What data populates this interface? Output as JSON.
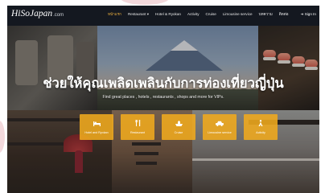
{
  "brand": {
    "logo_main": "HiSoJapan",
    "logo_suffix": ".com"
  },
  "nav": {
    "items": [
      {
        "label": "หน้าแรก",
        "active": true
      },
      {
        "label": "Restaurant ▾",
        "active": false
      },
      {
        "label": "Hotel & Ryokan",
        "active": false
      },
      {
        "label": "Activity",
        "active": false
      },
      {
        "label": "Cruise",
        "active": false
      },
      {
        "label": "Limousine service",
        "active": false
      },
      {
        "label": "บทความ",
        "active": false
      },
      {
        "label": "ติดต่อ",
        "active": false
      }
    ],
    "signin": "➜ Sign In"
  },
  "hero": {
    "headline": "ช่วยให้คุณเพลิดเพลินกับการท่องเที่ยวญี่ปุ่น",
    "subheadline": "Find great places , hotels , restaurants , shops and more for VIPs."
  },
  "categories": [
    {
      "label": "Hotel and Ryokan",
      "icon": "bed-icon"
    },
    {
      "label": "Restaurant",
      "icon": "cutlery-icon"
    },
    {
      "label": "Cruise",
      "icon": "ship-icon"
    },
    {
      "label": "Limousine service",
      "icon": "car-icon"
    },
    {
      "label": "Activity",
      "icon": "activity-icon"
    }
  ],
  "colors": {
    "header_bg": "#141820",
    "accent": "#f0b23e",
    "category_tile": "#f0aa1e"
  }
}
